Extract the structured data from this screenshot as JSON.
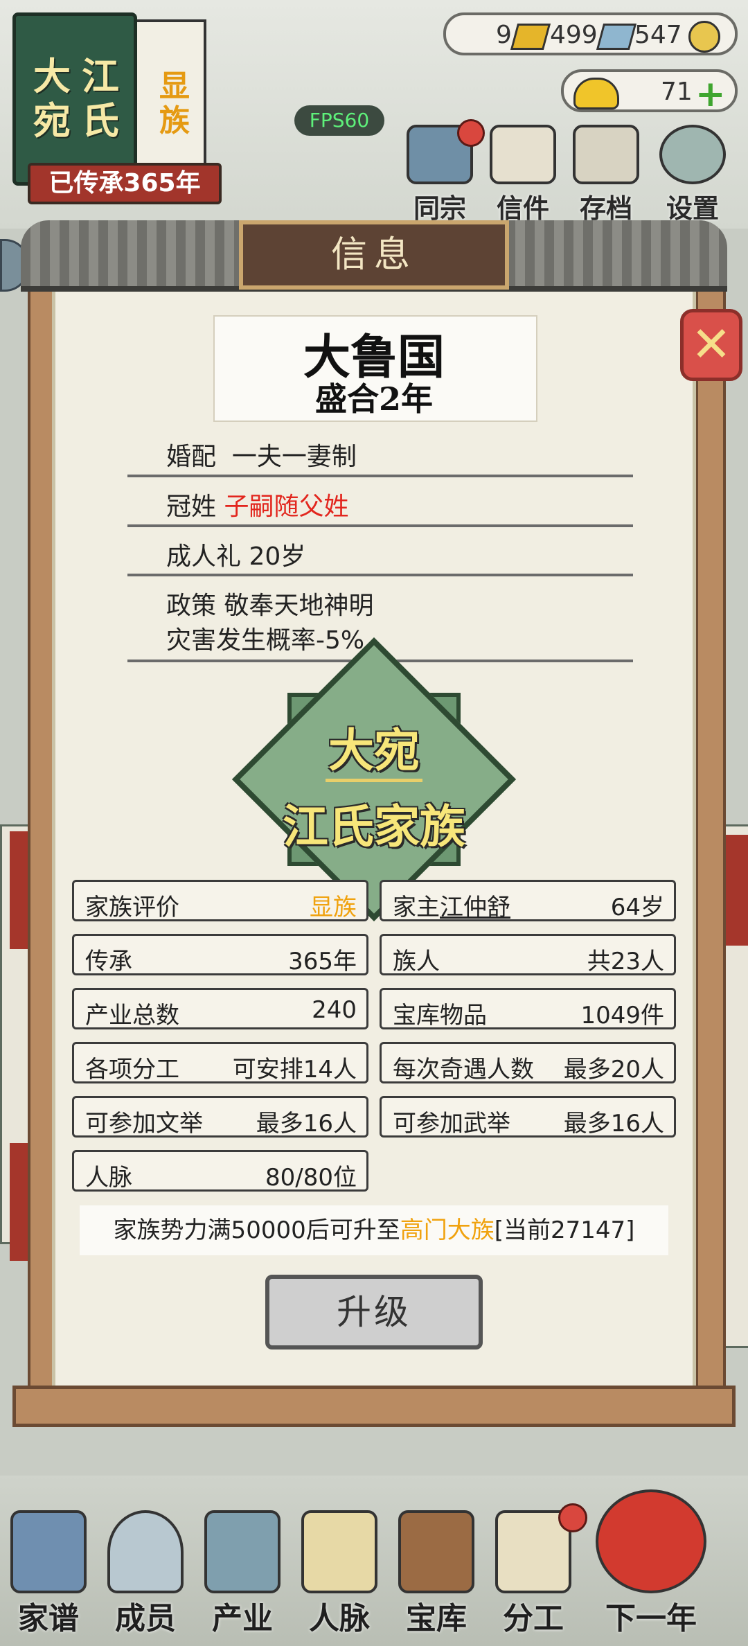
{
  "header": {
    "family_book": {
      "name_line1": "大宛",
      "name_line2": "江氏",
      "rank": "显族",
      "inherited": "已传承365年"
    },
    "fps": "FPS60",
    "currency": {
      "gold_bars": "9",
      "silver_bars": "499",
      "coins": "547",
      "ingots": "71"
    },
    "menu": [
      {
        "label": "同宗",
        "icon": "ancestor-books-icon"
      },
      {
        "label": "信件",
        "icon": "letter-icon"
      },
      {
        "label": "存档",
        "icon": "save-scroll-icon"
      },
      {
        "label": "设置",
        "icon": "gear-icon"
      }
    ]
  },
  "dialog": {
    "title": "信息",
    "country": "大鲁国",
    "era": "盛合2年",
    "marriage": {
      "label": "婚配",
      "value": "一夫一妻制"
    },
    "surname": {
      "label": "冠姓",
      "value": "子嗣随父姓"
    },
    "adulthood": {
      "label": "成人礼",
      "value": "20岁"
    },
    "policy": {
      "label": "政策",
      "value": "敬奉天地神明",
      "effect": "灾害发生概率-5%"
    },
    "emblem": {
      "line1": "大宛",
      "line2": "江氏家族"
    },
    "stats": {
      "rating": {
        "label": "家族评价",
        "value": "显族"
      },
      "head": {
        "label": "家主",
        "name": "江仲舒",
        "age": "64岁"
      },
      "inheritance": {
        "label": "传承",
        "value": "365年"
      },
      "members": {
        "label": "族人",
        "value": "共23人"
      },
      "industry": {
        "label": "产业总数",
        "value": "240"
      },
      "treasury": {
        "label": "宝库物品",
        "value": "1049件"
      },
      "division": {
        "label": "各项分工",
        "value": "可安排14人"
      },
      "adventure": {
        "label": "每次奇遇人数",
        "value": "最多20人"
      },
      "civil_exam": {
        "label": "可参加文举",
        "value": "最多16人"
      },
      "military_exam": {
        "label": "可参加武举",
        "value": "最多16人"
      },
      "connections": {
        "label": "人脉",
        "value": "80/80位"
      }
    },
    "notice": {
      "prefix": "家族势力满50000后可升至",
      "target": "高门大族",
      "suffix": "[当前27147]"
    },
    "upgrade_label": "升级"
  },
  "bottom_nav": [
    {
      "label": "家谱",
      "icon": "genealogy-book-icon"
    },
    {
      "label": "成员",
      "icon": "member-portrait-icon"
    },
    {
      "label": "产业",
      "icon": "pavilion-icon"
    },
    {
      "label": "人脉",
      "icon": "network-icon"
    },
    {
      "label": "宝库",
      "icon": "treasure-chest-icon"
    },
    {
      "label": "分工",
      "icon": "scroll-icon"
    },
    {
      "label": "下一年",
      "icon": "spring-lantern-icon"
    }
  ],
  "colors": {
    "accent_orange": "#f0a20e",
    "accent_red": "#e2261e",
    "panel": "#f1eee2"
  }
}
